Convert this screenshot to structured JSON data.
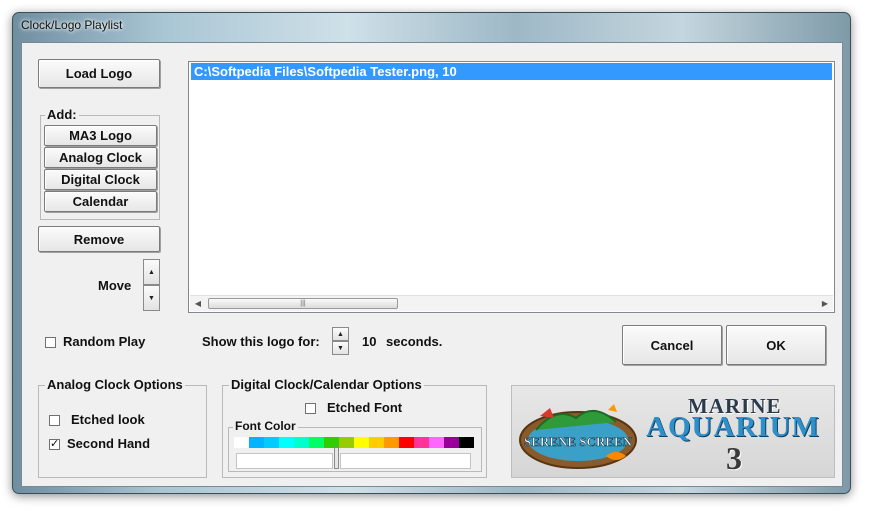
{
  "window": {
    "title": "Clock/Logo Playlist"
  },
  "buttons": {
    "load_logo": "Load  Logo",
    "ma3_logo": "MA3 Logo",
    "analog_clock": "Analog Clock",
    "digital_clock": "Digital Clock",
    "calendar": "Calendar",
    "remove": "Remove",
    "cancel": "Cancel",
    "ok": "OK"
  },
  "add_group": {
    "title": "Add:"
  },
  "move": {
    "label": "Move"
  },
  "playlist": {
    "items": [
      "C:\\Softpedia Files\\Softpedia Tester.png, 10"
    ],
    "selected_index": 0
  },
  "random_play": {
    "label": "Random Play",
    "checked": false
  },
  "show_logo": {
    "prefix": "Show this logo for:",
    "value": "10",
    "suffix": "seconds."
  },
  "analog_options": {
    "title": "Analog Clock Options",
    "etched_look": {
      "label": "Etched look",
      "checked": false
    },
    "second_hand": {
      "label": "Second Hand",
      "checked": true
    }
  },
  "digital_options": {
    "title": "Digital Clock/Calendar Options",
    "etched_font": {
      "label": "Etched Font",
      "checked": false
    },
    "font_color": {
      "label": "Font Color",
      "swatches": [
        "#ffffff",
        "#00b4ff",
        "#00ccff",
        "#00ffff",
        "#00ffcc",
        "#00ff66",
        "#33cc00",
        "#99cc00",
        "#ffff00",
        "#ffcc00",
        "#ff9900",
        "#ff0000",
        "#ff3399",
        "#ff66ff",
        "#990099",
        "#000000"
      ]
    }
  },
  "logo": {
    "badge_text": "SERENE SCREEN",
    "marine": "MARINE",
    "aquarium": "AQUARIUM",
    "number": "3"
  }
}
